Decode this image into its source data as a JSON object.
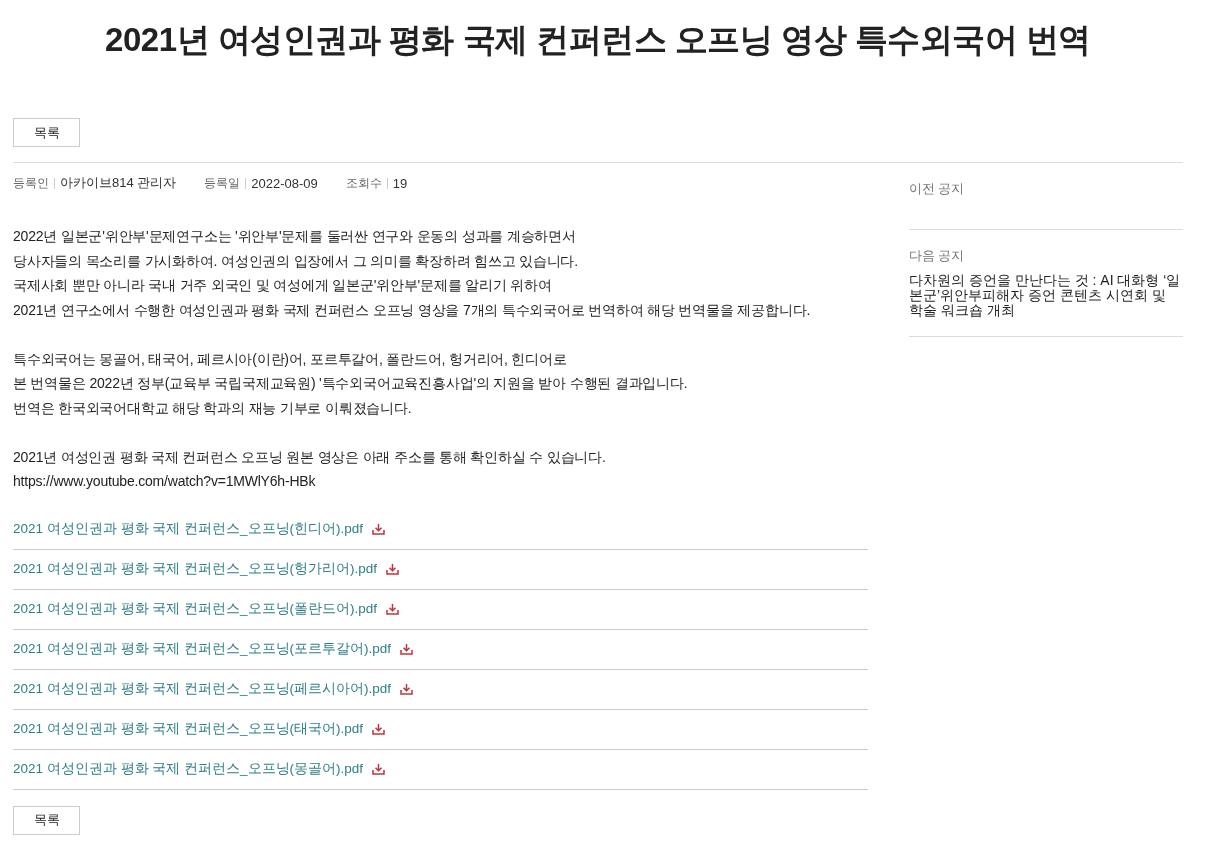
{
  "title": "2021년 여성인권과 평화 국제 컨퍼런스 오프닝 영상 특수외국어 번역",
  "list_button_top": "목록",
  "meta": [
    {
      "label": "등록인",
      "value": "아카이브814 관리자"
    },
    {
      "label": "등록일",
      "value": "2022-08-09"
    },
    {
      "label": "조회수",
      "value": "19"
    }
  ],
  "paragraphs": [
    [
      "2022년 일본군'위안부'문제연구소는 '위안부'문제를 둘러싼 연구와 운동의 성과를 계승하면서",
      "당사자들의 목소리를 가시화하여. 여성인권의 입장에서 그 의미를 확장하려 힘쓰고 있습니다.",
      "국제사회 뿐만 아니라 국내 거주 외국인 및 여성에게 일본군'위안부'문제를 알리기 위하여",
      "2021년 연구소에서 수행한 여성인권과 평화 국제 컨퍼런스 오프닝 영상을 7개의 특수외국어로 번역하여 해당 번역물을 제공합니다."
    ],
    [
      "특수외국어는 몽골어, 태국어, 페르시아(이란)어, 포르투갈어, 폴란드어, 헝거리어, 힌디어로",
      "본 번역물은 2022년 정부(교육부 국립국제교육원) '특수외국어교육진흥사업'의 지원을 받아 수행된 결과입니다.",
      "번역은 한국외국어대학교 해당 학과의 재능 기부로 이뤄졌습니다."
    ],
    [
      "2021년 여성인권 평화 국제 컨퍼런스 오프닝 원본 영상은 아래 주소를 통해 확인하실 수 있습니다.",
      "https://www.youtube.com/watch?v=1MWlY6h-HBk"
    ]
  ],
  "attachments": [
    "2021 여성인권과 평화 국제 컨퍼런스_오프닝(힌디어).pdf",
    "2021 여성인권과 평화 국제 컨퍼런스_오프닝(헝가리어).pdf",
    "2021 여성인권과 평화 국제 컨퍼런스_오프닝(폴란드어).pdf",
    "2021 여성인권과 평화 국제 컨퍼런스_오프닝(포르투갈어).pdf",
    "2021 여성인권과 평화 국제 컨퍼런스_오프닝(페르시아어).pdf",
    "2021 여성인권과 평화 국제 컨퍼런스_오프닝(태국어).pdf",
    "2021 여성인권과 평화 국제 컨퍼런스_오프닝(몽골어).pdf"
  ],
  "list_button_bottom": "목록",
  "sidebar": [
    {
      "label": "이전 공지"
    },
    {
      "label": "다음 공지",
      "title": "다차원의 증언을 만난다는 것 : AI 대화형 ‘일본군’위안부피해자 증언 콘텐츠 시연회 및 학술 워크숍 개최"
    }
  ]
}
